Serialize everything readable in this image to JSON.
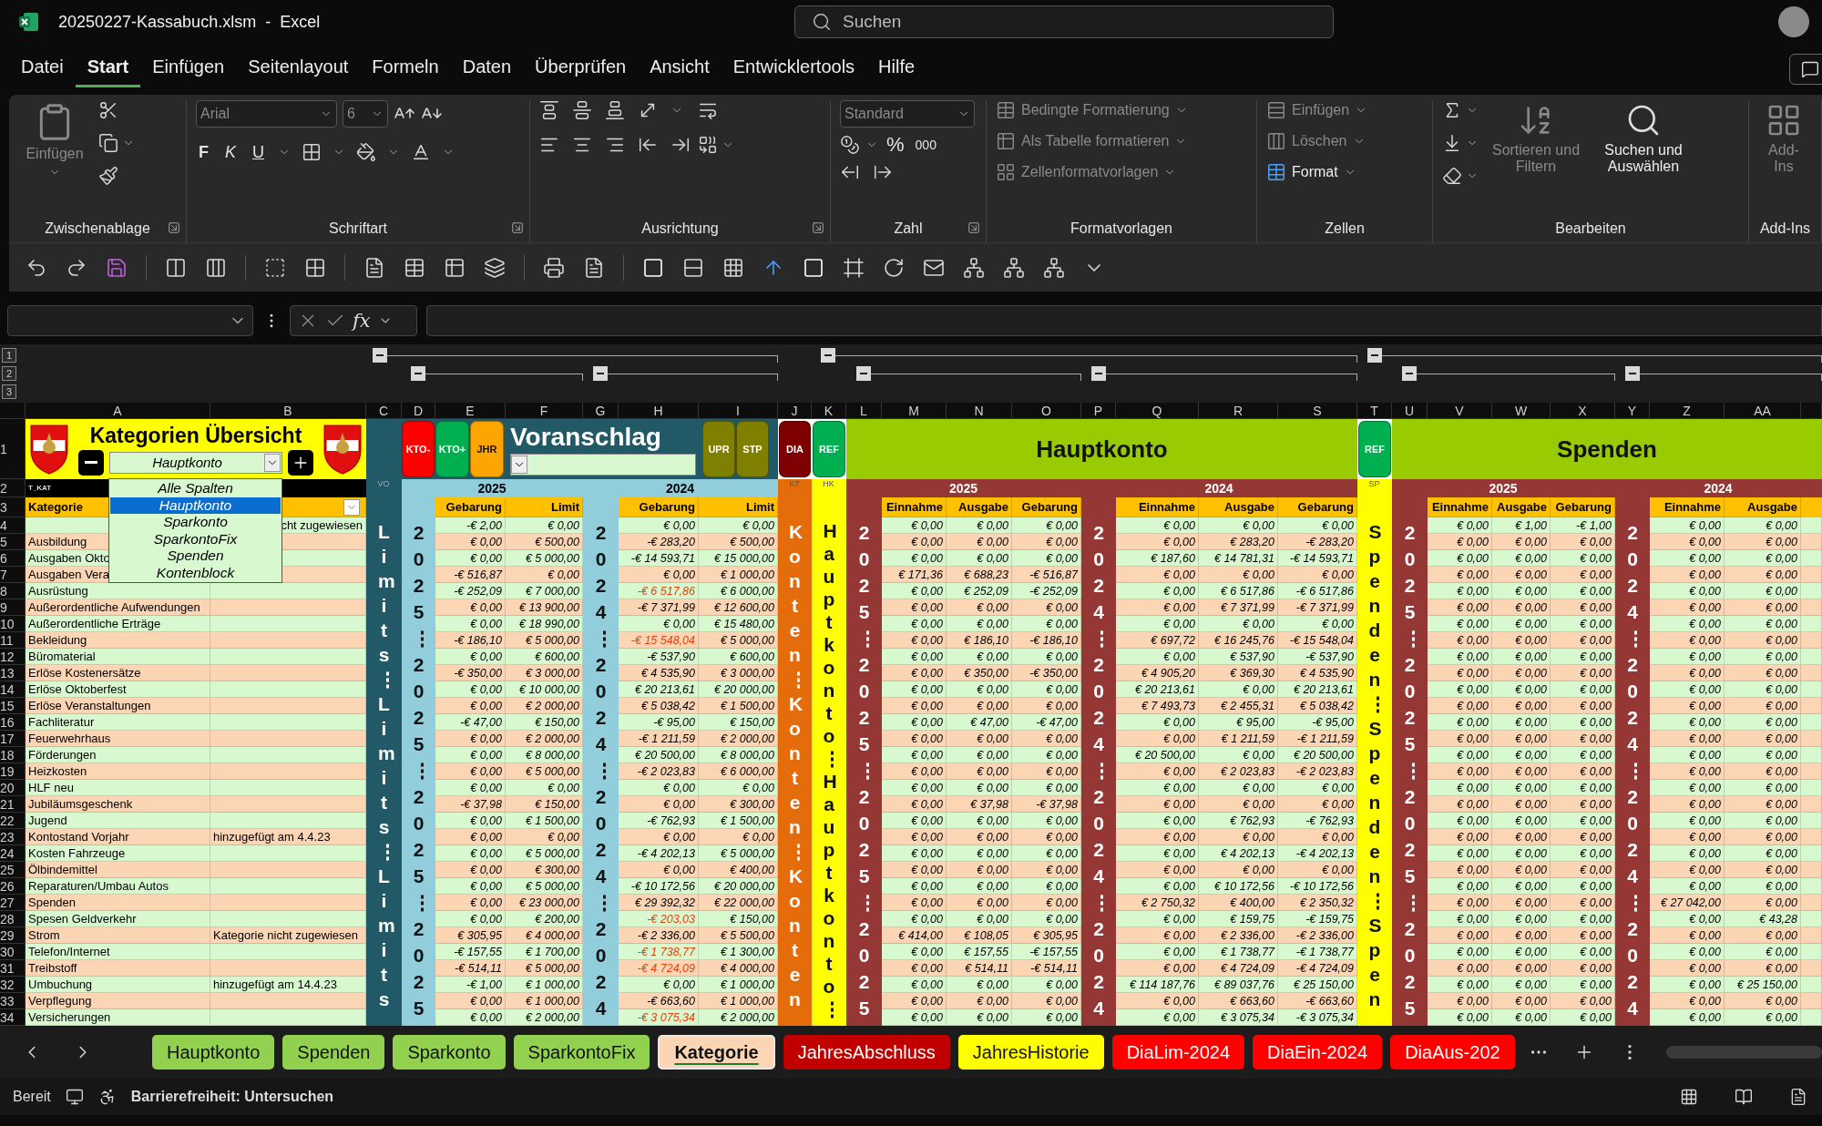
{
  "title_bar": {
    "title": "20250227-Kassabuch.xlsm  -  Excel",
    "search_placeholder": "Suchen"
  },
  "menu_tabs": [
    {
      "label": "Datei",
      "selected": false
    },
    {
      "label": "Start",
      "selected": true
    },
    {
      "label": "Einfügen",
      "selected": false
    },
    {
      "label": "Seitenlayout",
      "selected": false
    },
    {
      "label": "Formeln",
      "selected": false
    },
    {
      "label": "Daten",
      "selected": false
    },
    {
      "label": "Überprüfen",
      "selected": false
    },
    {
      "label": "Ansicht",
      "selected": false
    },
    {
      "label": "Entwicklertools",
      "selected": false
    },
    {
      "label": "Hilfe",
      "selected": false
    }
  ],
  "ribbon": {
    "clipboard": {
      "label": "Zwischenablage",
      "paste": {
        "label": "Einfügen",
        "disabled": true
      }
    },
    "font": {
      "label": "Schriftart",
      "font_name": "Arial",
      "font_size": "6",
      "disabled": true,
      "bold": "F",
      "italic": "K",
      "underline": "U"
    },
    "alignment": {
      "label": "Ausrichtung"
    },
    "number": {
      "label": "Zahl",
      "format": "Standard",
      "percent": "%",
      "thousands": "000"
    },
    "styles": {
      "label": "Formatvorlagen",
      "items": [
        {
          "label": "Bedingte Formatierung",
          "disabled": true
        },
        {
          "label": "Als Tabelle formatieren",
          "disabled": true
        },
        {
          "label": "Zellenformatvorlagen",
          "disabled": true
        }
      ]
    },
    "cells": {
      "label": "Zellen",
      "items": [
        {
          "label": "Einfügen",
          "disabled": true
        },
        {
          "label": "Löschen",
          "disabled": true
        },
        {
          "label": "Format",
          "disabled": false
        }
      ]
    },
    "editing": {
      "label": "Bearbeiten",
      "sort": {
        "label": "Sortieren und Filtern",
        "disabled": true
      },
      "find": {
        "label": "Suchen und Auswählen",
        "disabled": false
      }
    },
    "addins": {
      "label": "Add-Ins",
      "button": {
        "label": "Add-Ins",
        "disabled": true
      }
    }
  },
  "formula_bar": {
    "fx": "fx"
  },
  "outline": {
    "levels": [
      "1",
      "2",
      "3"
    ]
  },
  "sheet": {
    "columns": [
      "A",
      "B",
      "C",
      "D",
      "E",
      "F",
      "G",
      "H",
      "I",
      "J",
      "K",
      "L",
      "M",
      "N",
      "O",
      "P",
      "Q",
      "R",
      "S",
      "T",
      "U",
      "V",
      "W",
      "X",
      "Y",
      "Z",
      "AA"
    ],
    "row_numbers": [
      "1",
      "2",
      "3"
    ],
    "title": "Kategorien Übersicht",
    "category_filter": "Hauptkonto",
    "filter_options": [
      {
        "label": "Alle Spalten",
        "selected": false
      },
      {
        "label": "Hauptkonto",
        "selected": true
      },
      {
        "label": "Sparkonto",
        "selected": false
      },
      {
        "label": "SparkontoFix",
        "selected": false
      },
      {
        "label": "Spenden",
        "selected": false
      },
      {
        "label": "Kontenblock",
        "selected": false
      }
    ],
    "buttons_left": [
      {
        "label": "KTO-",
        "color": "#ff0000"
      },
      {
        "label": "KTO+",
        "color": "#00b050"
      },
      {
        "label": "JHR",
        "color": "#ffa500"
      }
    ],
    "voranschlag": "Voranschlag",
    "buttons_right": [
      {
        "label": "UPR",
        "color": "#808000"
      },
      {
        "label": "STP",
        "color": "#808000"
      }
    ],
    "dia_button": {
      "label": "DIA",
      "color": "#7f0000"
    },
    "banners": [
      {
        "ref": "REF",
        "title": "Hauptkonto"
      },
      {
        "ref": "REF",
        "title": "Spenden"
      }
    ],
    "section_labels": {
      "table_name": "T_KAT",
      "vo": "VO",
      "kt": "KT",
      "hk": "HK",
      "sp": "SP"
    },
    "year_headers": [
      "2025",
      "2024",
      "2025",
      "2024",
      "2025",
      "2024"
    ],
    "column_headings": [
      "Kategorie",
      "Gebarung",
      "Limit",
      "Gebarung",
      "Limit",
      "Einnahme",
      "Ausgabe",
      "Gebarung",
      "Einnahme",
      "Ausgabe",
      "Gebarung",
      "Einnahme",
      "Ausgabe",
      "Gebarung",
      "Einnahme",
      "Ausgabe"
    ],
    "bands": [
      {
        "text": "Limits⋮Limits⋮Limits",
        "color": "#215967"
      },
      {
        "text": "2025⋮2025⋮2025⋮2025",
        "color": "#92cddc"
      },
      {
        "text": "2024⋮2024⋮2024⋮2024",
        "color": "#92cddc"
      },
      {
        "text": "Konten⋮Konten⋮Konten",
        "color": "#e46c0a"
      },
      {
        "text": "Hauptkonto⋮Hauptkonto⋮",
        "color": "#ffff00"
      },
      {
        "text": "2025⋮2025⋮2025⋮2025",
        "color": "#953735"
      },
      {
        "text": "2024⋮2024⋮2024⋮2024",
        "color": "#953735"
      },
      {
        "text": "Spenden⋮Spenden⋮Spen",
        "color": "#ffff00"
      },
      {
        "text": "2025⋮2025⋮2025⋮2025",
        "color": "#953735"
      },
      {
        "text": "2024⋮2024⋮2024⋮2024",
        "color": "#953735"
      }
    ],
    "rows": [
      {
        "n": "4",
        "note": "cht zugewiesen",
        "over_limit": false,
        "values": [
          "-€ 2,00",
          "€ 0,00",
          "€ 0,00",
          "€ 0,00",
          "€ 0,00",
          "€ 0,00",
          "€ 0,00",
          "€ 0,00",
          "€ 0,00",
          "€ 0,00",
          "€ 0,00",
          "€ 1,00",
          "-€ 1,00",
          "€ 0,00",
          "€ 0,00"
        ]
      },
      {
        "n": "5",
        "category": "Ausbildung",
        "over_limit": false,
        "values": [
          "€ 0,00",
          "€ 500,00",
          "-€ 283,20",
          "€ 500,00",
          "€ 0,00",
          "€ 0,00",
          "€ 0,00",
          "€ 0,00",
          "€ 283,20",
          "-€ 283,20",
          "€ 0,00",
          "€ 0,00",
          "€ 0,00",
          "€ 0,00",
          "€ 0,00"
        ]
      },
      {
        "n": "6",
        "category": "Ausgaben Okto",
        "over_limit": false,
        "values": [
          "€ 0,00",
          "€ 5 000,00",
          "-€ 14 593,71",
          "€ 15 000,00",
          "€ 0,00",
          "€ 0,00",
          "€ 0,00",
          "€ 187,60",
          "€ 14 781,31",
          "-€ 14 593,71",
          "€ 0,00",
          "€ 0,00",
          "€ 0,00",
          "€ 0,00",
          "€ 0,00"
        ]
      },
      {
        "n": "7",
        "category": "Ausgaben Vera",
        "over_limit": false,
        "values": [
          "-€ 516,87",
          "€ 0,00",
          "€ 0,00",
          "€ 1 000,00",
          "€ 171,36",
          "€ 688,23",
          "-€ 516,87",
          "€ 0,00",
          "€ 0,00",
          "€ 0,00",
          "€ 0,00",
          "€ 0,00",
          "€ 0,00",
          "€ 0,00",
          "€ 0,00"
        ]
      },
      {
        "n": "8",
        "category": "Ausrüstung",
        "over_limit": true,
        "values": [
          "-€ 252,09",
          "€ 7 000,00",
          "-€ 6 517,86",
          "€ 6 000,00",
          "€ 0,00",
          "€ 252,09",
          "-€ 252,09",
          "€ 0,00",
          "€ 6 517,86",
          "-€ 6 517,86",
          "€ 0,00",
          "€ 0,00",
          "€ 0,00",
          "€ 0,00",
          "€ 0,00"
        ]
      },
      {
        "n": "9",
        "category": "Außerordentliche Aufwendungen",
        "over_limit": false,
        "values": [
          "€ 0,00",
          "€ 13 900,00",
          "-€ 7 371,99",
          "€ 12 600,00",
          "€ 0,00",
          "€ 0,00",
          "€ 0,00",
          "€ 0,00",
          "€ 7 371,99",
          "-€ 7 371,99",
          "€ 0,00",
          "€ 0,00",
          "€ 0,00",
          "€ 0,00",
          "€ 0,00"
        ]
      },
      {
        "n": "10",
        "category": "Außerordentliche Erträge",
        "over_limit": false,
        "values": [
          "€ 0,00",
          "€ 18 990,00",
          "€ 0,00",
          "€ 15 480,00",
          "€ 0,00",
          "€ 0,00",
          "€ 0,00",
          "€ 0,00",
          "€ 0,00",
          "€ 0,00",
          "€ 0,00",
          "€ 0,00",
          "€ 0,00",
          "€ 0,00",
          "€ 0,00"
        ]
      },
      {
        "n": "11",
        "category": "Bekleidung",
        "over_limit": true,
        "values": [
          "-€ 186,10",
          "€ 5 000,00",
          "-€ 15 548,04",
          "€ 5 000,00",
          "€ 0,00",
          "€ 186,10",
          "-€ 186,10",
          "€ 697,72",
          "€ 16 245,76",
          "-€ 15 548,04",
          "€ 0,00",
          "€ 0,00",
          "€ 0,00",
          "€ 0,00",
          "€ 0,00"
        ]
      },
      {
        "n": "12",
        "category": "Büromaterial",
        "over_limit": false,
        "values": [
          "€ 0,00",
          "€ 600,00",
          "-€ 537,90",
          "€ 600,00",
          "€ 0,00",
          "€ 0,00",
          "€ 0,00",
          "€ 0,00",
          "€ 537,90",
          "-€ 537,90",
          "€ 0,00",
          "€ 0,00",
          "€ 0,00",
          "€ 0,00",
          "€ 0,00"
        ]
      },
      {
        "n": "13",
        "category": "Erlöse Kostenersätze",
        "over_limit": false,
        "values": [
          "-€ 350,00",
          "€ 3 000,00",
          "€ 4 535,90",
          "€ 3 000,00",
          "€ 0,00",
          "€ 350,00",
          "-€ 350,00",
          "€ 4 905,20",
          "€ 369,30",
          "€ 4 535,90",
          "€ 0,00",
          "€ 0,00",
          "€ 0,00",
          "€ 0,00",
          "€ 0,00"
        ]
      },
      {
        "n": "14",
        "category": "Erlöse Oktoberfest",
        "over_limit": false,
        "values": [
          "€ 0,00",
          "€ 10 000,00",
          "€ 20 213,61",
          "€ 20 000,00",
          "€ 0,00",
          "€ 0,00",
          "€ 0,00",
          "€ 20 213,61",
          "€ 0,00",
          "€ 20 213,61",
          "€ 0,00",
          "€ 0,00",
          "€ 0,00",
          "€ 0,00",
          "€ 0,00"
        ]
      },
      {
        "n": "15",
        "category": "Erlöse Veranstaltungen",
        "over_limit": false,
        "values": [
          "€ 0,00",
          "€ 2 000,00",
          "€ 5 038,42",
          "€ 1 500,00",
          "€ 0,00",
          "€ 0,00",
          "€ 0,00",
          "€ 7 493,73",
          "€ 2 455,31",
          "€ 5 038,42",
          "€ 0,00",
          "€ 0,00",
          "€ 0,00",
          "€ 0,00",
          "€ 0,00"
        ]
      },
      {
        "n": "16",
        "category": "Fachliteratur",
        "over_limit": false,
        "values": [
          "-€ 47,00",
          "€ 150,00",
          "-€ 95,00",
          "€ 150,00",
          "€ 0,00",
          "€ 47,00",
          "-€ 47,00",
          "€ 0,00",
          "€ 95,00",
          "-€ 95,00",
          "€ 0,00",
          "€ 0,00",
          "€ 0,00",
          "€ 0,00",
          "€ 0,00"
        ]
      },
      {
        "n": "17",
        "category": "Feuerwehrhaus",
        "over_limit": false,
        "values": [
          "€ 0,00",
          "€ 2 000,00",
          "-€ 1 211,59",
          "€ 2 000,00",
          "€ 0,00",
          "€ 0,00",
          "€ 0,00",
          "€ 0,00",
          "€ 1 211,59",
          "-€ 1 211,59",
          "€ 0,00",
          "€ 0,00",
          "€ 0,00",
          "€ 0,00",
          "€ 0,00"
        ]
      },
      {
        "n": "18",
        "category": "Förderungen",
        "over_limit": false,
        "values": [
          "€ 0,00",
          "€ 8 000,00",
          "€ 20 500,00",
          "€ 8 000,00",
          "€ 0,00",
          "€ 0,00",
          "€ 0,00",
          "€ 20 500,00",
          "€ 0,00",
          "€ 20 500,00",
          "€ 0,00",
          "€ 0,00",
          "€ 0,00",
          "€ 0,00",
          "€ 0,00"
        ]
      },
      {
        "n": "19",
        "category": "Heizkosten",
        "over_limit": false,
        "values": [
          "€ 0,00",
          "€ 5 000,00",
          "-€ 2 023,83",
          "€ 6 000,00",
          "€ 0,00",
          "€ 0,00",
          "€ 0,00",
          "€ 0,00",
          "€ 2 023,83",
          "-€ 2 023,83",
          "€ 0,00",
          "€ 0,00",
          "€ 0,00",
          "€ 0,00",
          "€ 0,00"
        ]
      },
      {
        "n": "20",
        "category": "HLF neu",
        "over_limit": false,
        "values": [
          "€ 0,00",
          "€ 0,00",
          "€ 0,00",
          "€ 0,00",
          "€ 0,00",
          "€ 0,00",
          "€ 0,00",
          "€ 0,00",
          "€ 0,00",
          "€ 0,00",
          "€ 0,00",
          "€ 0,00",
          "€ 0,00",
          "€ 0,00",
          "€ 0,00"
        ]
      },
      {
        "n": "21",
        "category": "Jubiläumsgeschenk",
        "over_limit": false,
        "values": [
          "-€ 37,98",
          "€ 150,00",
          "€ 0,00",
          "€ 300,00",
          "€ 0,00",
          "€ 37,98",
          "-€ 37,98",
          "€ 0,00",
          "€ 0,00",
          "€ 0,00",
          "€ 0,00",
          "€ 0,00",
          "€ 0,00",
          "€ 0,00",
          "€ 0,00"
        ]
      },
      {
        "n": "22",
        "category": "Jugend",
        "over_limit": false,
        "values": [
          "€ 0,00",
          "€ 1 500,00",
          "-€ 762,93",
          "€ 1 500,00",
          "€ 0,00",
          "€ 0,00",
          "€ 0,00",
          "€ 0,00",
          "€ 762,93",
          "-€ 762,93",
          "€ 0,00",
          "€ 0,00",
          "€ 0,00",
          "€ 0,00",
          "€ 0,00"
        ]
      },
      {
        "n": "23",
        "category": "Kontostand Vorjahr",
        "note": "hinzugefügt am 4.4.23",
        "over_limit": false,
        "values": [
          "€ 0,00",
          "€ 0,00",
          "€ 0,00",
          "€ 0,00",
          "€ 0,00",
          "€ 0,00",
          "€ 0,00",
          "€ 0,00",
          "€ 0,00",
          "€ 0,00",
          "€ 0,00",
          "€ 0,00",
          "€ 0,00",
          "€ 0,00",
          "€ 0,00"
        ]
      },
      {
        "n": "24",
        "category": "Kosten Fahrzeuge",
        "over_limit": false,
        "values": [
          "€ 0,00",
          "€ 5 000,00",
          "-€ 4 202,13",
          "€ 5 000,00",
          "€ 0,00",
          "€ 0,00",
          "€ 0,00",
          "€ 0,00",
          "€ 4 202,13",
          "-€ 4 202,13",
          "€ 0,00",
          "€ 0,00",
          "€ 0,00",
          "€ 0,00",
          "€ 0,00"
        ]
      },
      {
        "n": "25",
        "category": "Ölbindemittel",
        "over_limit": false,
        "values": [
          "€ 0,00",
          "€ 300,00",
          "€ 0,00",
          "€ 400,00",
          "€ 0,00",
          "€ 0,00",
          "€ 0,00",
          "€ 0,00",
          "€ 0,00",
          "€ 0,00",
          "€ 0,00",
          "€ 0,00",
          "€ 0,00",
          "€ 0,00",
          "€ 0,00"
        ]
      },
      {
        "n": "26",
        "category": "Reparaturen/Umbau Autos",
        "over_limit": false,
        "values": [
          "€ 0,00",
          "€ 5 000,00",
          "-€ 10 172,56",
          "€ 20 000,00",
          "€ 0,00",
          "€ 0,00",
          "€ 0,00",
          "€ 0,00",
          "€ 10 172,56",
          "-€ 10 172,56",
          "€ 0,00",
          "€ 0,00",
          "€ 0,00",
          "€ 0,00",
          "€ 0,00"
        ]
      },
      {
        "n": "27",
        "category": "Spenden",
        "over_limit": false,
        "values": [
          "€ 0,00",
          "€ 23 000,00",
          "€ 29 392,32",
          "€ 22 000,00",
          "€ 0,00",
          "€ 0,00",
          "€ 0,00",
          "€ 2 750,32",
          "€ 400,00",
          "€ 2 350,32",
          "€ 0,00",
          "€ 0,00",
          "€ 0,00",
          "€ 27 042,00",
          "€ 0,00"
        ]
      },
      {
        "n": "28",
        "category": "Spesen Geldverkehr",
        "over_limit": true,
        "values": [
          "€ 0,00",
          "€ 200,00",
          "-€ 203,03",
          "€ 150,00",
          "€ 0,00",
          "€ 0,00",
          "€ 0,00",
          "€ 0,00",
          "€ 159,75",
          "-€ 159,75",
          "€ 0,00",
          "€ 0,00",
          "€ 0,00",
          "€ 0,00",
          "€ 43,28"
        ]
      },
      {
        "n": "29",
        "category": "Strom",
        "note": "Kategorie nicht zugewiesen",
        "over_limit": false,
        "values": [
          "€ 305,95",
          "€ 4 000,00",
          "-€ 2 336,00",
          "€ 5 500,00",
          "€ 414,00",
          "€ 108,05",
          "€ 305,95",
          "€ 0,00",
          "€ 2 336,00",
          "-€ 2 336,00",
          "€ 0,00",
          "€ 0,00",
          "€ 0,00",
          "€ 0,00",
          "€ 0,00"
        ]
      },
      {
        "n": "30",
        "category": "Telefon/Internet",
        "over_limit": true,
        "values": [
          "-€ 157,55",
          "€ 1 700,00",
          "-€ 1 738,77",
          "€ 1 300,00",
          "€ 0,00",
          "€ 157,55",
          "-€ 157,55",
          "€ 0,00",
          "€ 1 738,77",
          "-€ 1 738,77",
          "€ 0,00",
          "€ 0,00",
          "€ 0,00",
          "€ 0,00",
          "€ 0,00"
        ]
      },
      {
        "n": "31",
        "category": "Treibstoff",
        "over_limit": true,
        "values": [
          "-€ 514,11",
          "€ 5 000,00",
          "-€ 4 724,09",
          "€ 4 000,00",
          "€ 0,00",
          "€ 514,11",
          "-€ 514,11",
          "€ 0,00",
          "€ 4 724,09",
          "-€ 4 724,09",
          "€ 0,00",
          "€ 0,00",
          "€ 0,00",
          "€ 0,00",
          "€ 0,00"
        ]
      },
      {
        "n": "32",
        "category": "Umbuchung",
        "note": "hinzugefügt am 14.4.23",
        "over_limit": false,
        "values": [
          "-€ 1,00",
          "€ 1 000,00",
          "€ 0,00",
          "€ 1 000,00",
          "€ 0,00",
          "€ 0,00",
          "€ 0,00",
          "€ 114 187,76",
          "€ 89 037,76",
          "€ 25 150,00",
          "€ 0,00",
          "€ 0,00",
          "€ 0,00",
          "€ 0,00",
          "€ 25 150,00"
        ]
      },
      {
        "n": "33",
        "category": "Verpflegung",
        "over_limit": false,
        "values": [
          "€ 0,00",
          "€ 1 000,00",
          "-€ 663,60",
          "€ 1 000,00",
          "€ 0,00",
          "€ 0,00",
          "€ 0,00",
          "€ 0,00",
          "€ 663,60",
          "-€ 663,60",
          "€ 0,00",
          "€ 0,00",
          "€ 0,00",
          "€ 0,00",
          "€ 0,00"
        ]
      },
      {
        "n": "34",
        "category": "Versicherungen",
        "over_limit": true,
        "values": [
          "€ 0,00",
          "€ 2 000,00",
          "-€ 3 075,34",
          "€ 2 000,00",
          "€ 0,00",
          "€ 0,00",
          "€ 0,00",
          "€ 0,00",
          "€ 3 075,34",
          "-€ 3 075,34",
          "€ 0,00",
          "€ 0,00",
          "€ 0,00",
          "€ 0,00",
          "€ 0,00"
        ]
      }
    ]
  },
  "sheet_tabs": [
    {
      "label": "Hauptkonto",
      "color": "#92d050",
      "selected": false
    },
    {
      "label": "Spenden",
      "color": "#92d050",
      "selected": false
    },
    {
      "label": "Sparkonto",
      "color": "#92d050",
      "selected": false
    },
    {
      "label": "SparkontoFix",
      "color": "#92d050",
      "selected": false
    },
    {
      "label": "Kategorie",
      "color": "#fcd5b4",
      "selected": true
    },
    {
      "label": "JahresAbschluss",
      "color": "#c00000",
      "selected": false
    },
    {
      "label": "JahresHistorie",
      "color": "#ffff00",
      "selected": false
    },
    {
      "label": "DiaLim-2024",
      "color": "#ff0000",
      "selected": false
    },
    {
      "label": "DiaEin-2024",
      "color": "#ff0000",
      "selected": false
    },
    {
      "label": "DiaAus-202",
      "color": "#ff0000",
      "selected": false
    }
  ],
  "status_bar": {
    "state": "Bereit",
    "accessibility": "Barrierefreiheit: Untersuchen"
  }
}
